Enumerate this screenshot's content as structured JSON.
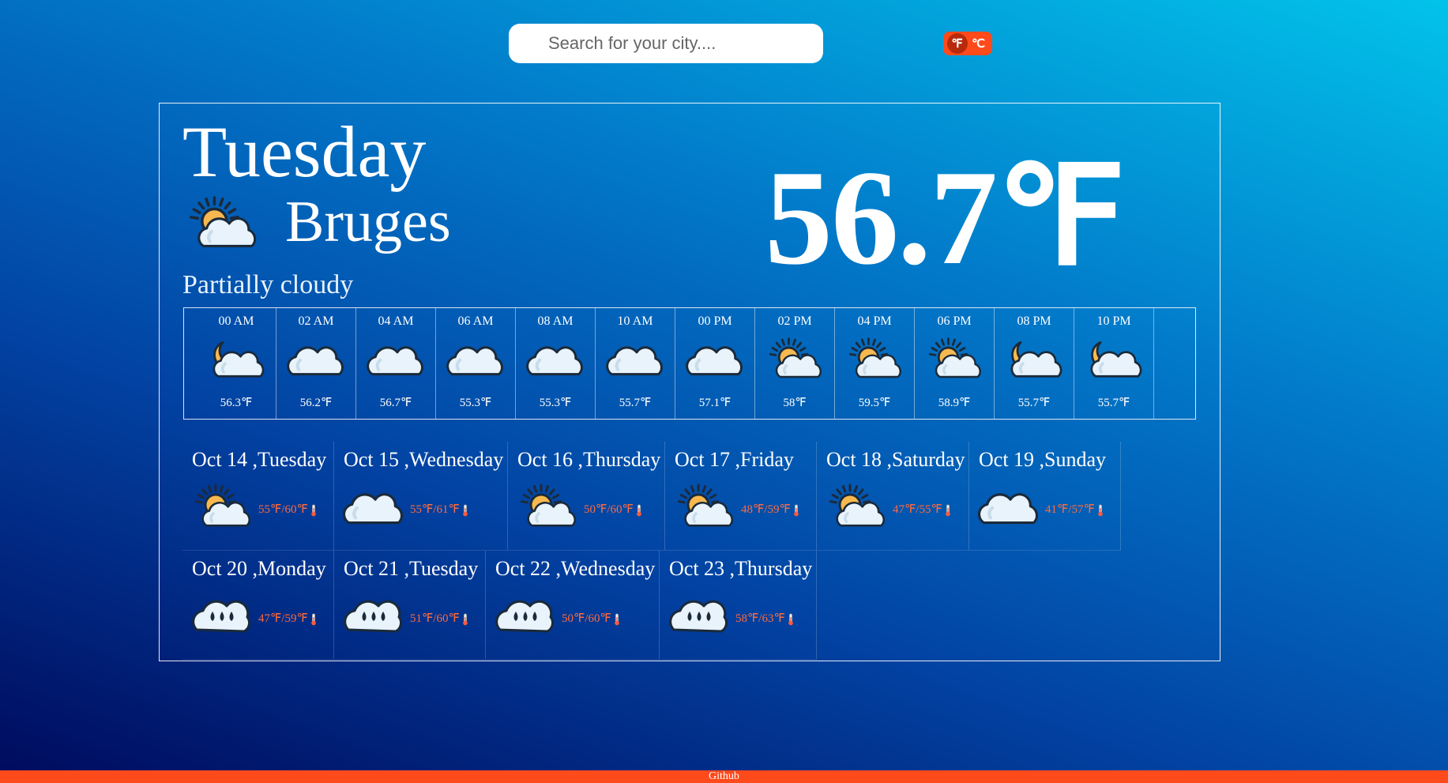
{
  "search": {
    "placeholder": "Search for your city...."
  },
  "units": {
    "fahrenheit": "℉",
    "celsius": "℃",
    "active": "fahrenheit"
  },
  "current": {
    "day": "Tuesday",
    "city": "Bruges",
    "temp": "56.7℉",
    "condition": "Partially cloudy",
    "icon": "partly-cloudy-day-icon"
  },
  "hourly": [
    {
      "time": "00 AM",
      "temp": "56.3℉",
      "icon": "partly-cloudy-night-icon"
    },
    {
      "time": "02 AM",
      "temp": "56.2℉",
      "icon": "cloudy-icon"
    },
    {
      "time": "04 AM",
      "temp": "56.7℉",
      "icon": "cloudy-icon"
    },
    {
      "time": "06 AM",
      "temp": "55.3℉",
      "icon": "cloudy-icon"
    },
    {
      "time": "08 AM",
      "temp": "55.3℉",
      "icon": "cloudy-icon"
    },
    {
      "time": "10 AM",
      "temp": "55.7℉",
      "icon": "cloudy-icon"
    },
    {
      "time": "00 PM",
      "temp": "57.1℉",
      "icon": "cloudy-icon"
    },
    {
      "time": "02 PM",
      "temp": "58℉",
      "icon": "partly-cloudy-day-icon"
    },
    {
      "time": "04 PM",
      "temp": "59.5℉",
      "icon": "partly-cloudy-day-icon"
    },
    {
      "time": "06 PM",
      "temp": "58.9℉",
      "icon": "partly-cloudy-day-icon"
    },
    {
      "time": "08 PM",
      "temp": "55.7℉",
      "icon": "partly-cloudy-night-icon"
    },
    {
      "time": "10 PM",
      "temp": "55.7℉",
      "icon": "partly-cloudy-night-icon"
    }
  ],
  "daily": [
    {
      "date": "Oct 14 ,Tuesday",
      "range": "55℉/60℉",
      "icon": "partly-cloudy-day-icon"
    },
    {
      "date": "Oct 15 ,Wednesday",
      "range": "55℉/61℉",
      "icon": "cloudy-icon"
    },
    {
      "date": "Oct 16 ,Thursday",
      "range": "50℉/60℉",
      "icon": "partly-cloudy-day-icon"
    },
    {
      "date": "Oct 17 ,Friday",
      "range": "48℉/59℉",
      "icon": "partly-cloudy-day-icon"
    },
    {
      "date": "Oct 18 ,Saturday",
      "range": "47℉/55℉",
      "icon": "partly-cloudy-day-icon"
    },
    {
      "date": "Oct 19 ,Sunday",
      "range": "41℉/57℉",
      "icon": "cloudy-icon"
    },
    {
      "date": "Oct 20 ,Monday",
      "range": "47℉/59℉",
      "icon": "rain-icon"
    },
    {
      "date": "Oct 21 ,Tuesday",
      "range": "51℉/60℉",
      "icon": "rain-icon"
    },
    {
      "date": "Oct 22 ,Wednesday",
      "range": "50℉/60℉",
      "icon": "rain-icon"
    },
    {
      "date": "Oct 23 ,Thursday",
      "range": "58℉/63℉",
      "icon": "rain-icon"
    }
  ],
  "footer": {
    "label": "Github"
  },
  "colors": {
    "accent": "#ff4a1c",
    "range_text": "#ff6a3d"
  }
}
